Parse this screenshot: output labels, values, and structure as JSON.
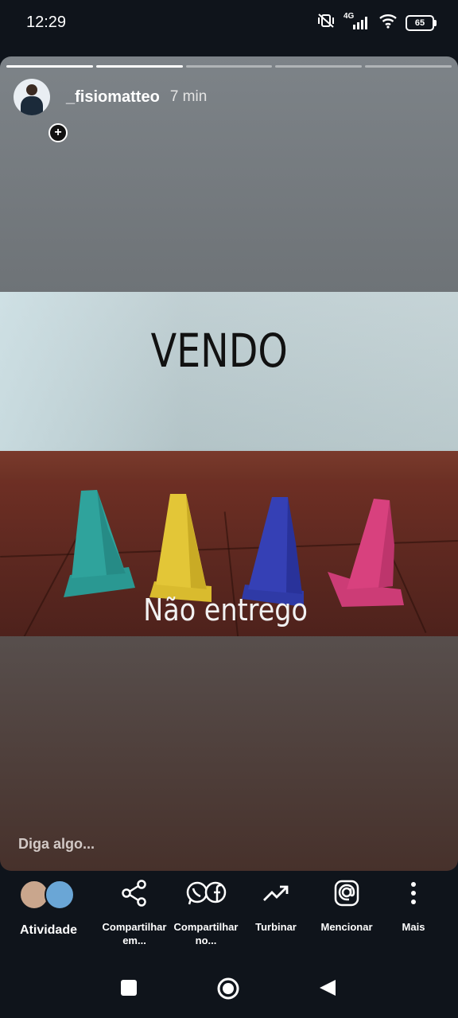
{
  "status_bar": {
    "time": "12:29",
    "network": "4G",
    "battery": "65"
  },
  "story": {
    "progress": {
      "segments": 5,
      "current": 2
    },
    "username": "_fisiomatteo",
    "timestamp": "7 min",
    "photo_text_top": "VENDO",
    "photo_text_bottom": "Não entrego",
    "reply_placeholder": "Diga algo..."
  },
  "actions": [
    {
      "label": "Atividade",
      "icon": "activity-avatars"
    },
    {
      "label": "Compartilhar em...",
      "icon": "share-icon"
    },
    {
      "label": "Compartilhar no...",
      "icon": "whatsapp-facebook-icon"
    },
    {
      "label": "Turbinar",
      "icon": "trending-up-icon"
    },
    {
      "label": "Mencionar",
      "icon": "at-icon"
    },
    {
      "label": "Mais",
      "icon": "more-vertical-icon"
    }
  ],
  "cones": [
    {
      "color": "#2fa39c"
    },
    {
      "color": "#e3c637"
    },
    {
      "color": "#3540b5"
    },
    {
      "color": "#d8417e"
    }
  ],
  "colors": {
    "background": "#0f141b",
    "progress_done": "#ffffff"
  }
}
